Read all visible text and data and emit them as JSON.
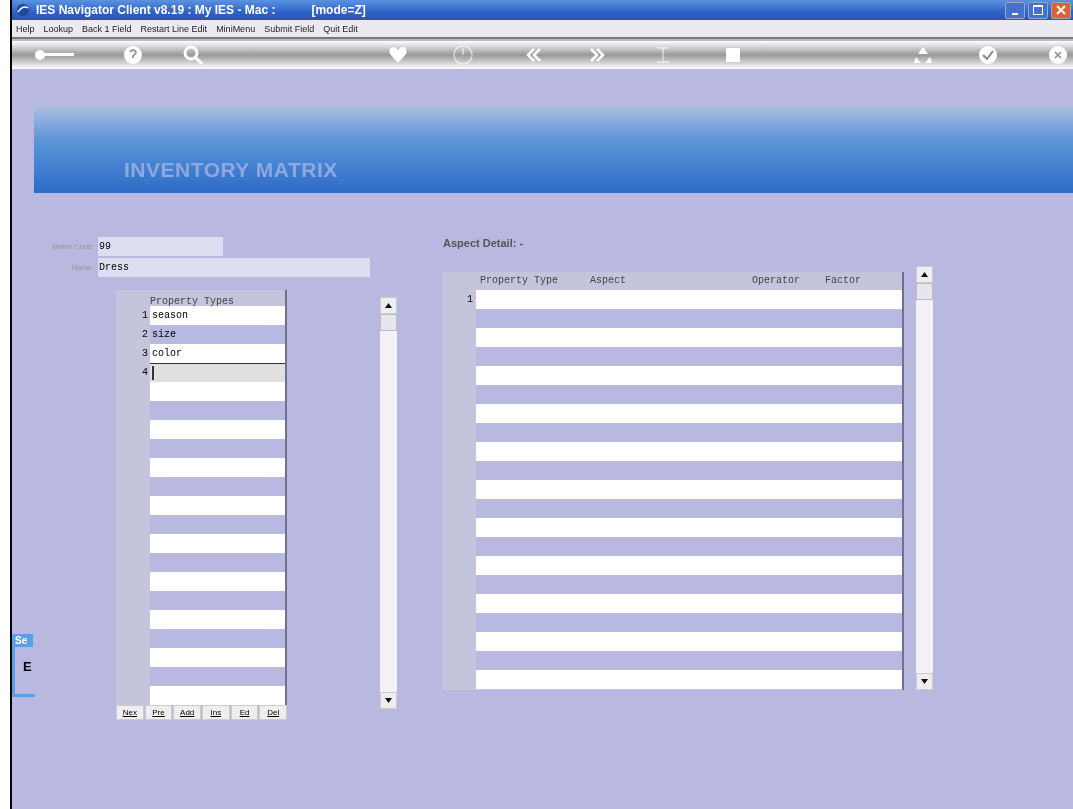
{
  "window": {
    "title": "IES Navigator Client v8.19 : My IES - Mac :",
    "mode": "[mode=Z]"
  },
  "menu": [
    "Help",
    "Lookup",
    "Back 1 Field",
    "Restart Line Edit",
    "MiniMenu",
    "Submit Field",
    "Quit Edit"
  ],
  "banner": {
    "title": "INVENTORY MATRIX"
  },
  "form": {
    "fields": [
      {
        "label": "Matrix Code",
        "value": "99"
      },
      {
        "label": "Name",
        "value": "Dress"
      }
    ]
  },
  "property_types": {
    "heading": "Property Types",
    "rows": [
      {
        "num": "1",
        "value": "season",
        "editing": false
      },
      {
        "num": "2",
        "value": "size",
        "editing": false
      },
      {
        "num": "3",
        "value": "color",
        "editing": false
      },
      {
        "num": "4",
        "editing": true
      }
    ],
    "buttons": [
      "Nex",
      "Pre",
      "Add",
      "Ins",
      "Ed",
      "Del"
    ]
  },
  "aspect_detail": {
    "title": "Aspect Detail: -",
    "columns": [
      "Property Type",
      "Aspect",
      "Operator",
      "Factor"
    ],
    "rows": [
      {
        "num": "1"
      }
    ]
  },
  "side_panel": {
    "tab": "Se",
    "glyph": "E"
  }
}
